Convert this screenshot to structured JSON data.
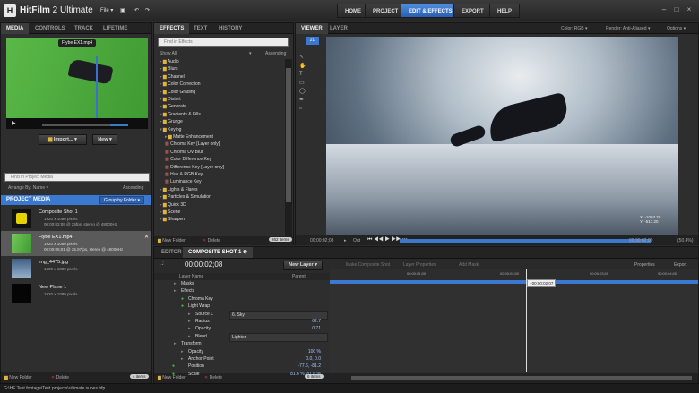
{
  "app": {
    "name": "HitFilm",
    "version": "2 Ultimate",
    "menu_file": "File",
    "undo": "↶",
    "redo": "↷"
  },
  "nav": [
    "HOME",
    "PROJECT",
    "EDIT & EFFECTS",
    "EXPORT",
    "HELP"
  ],
  "left_tabs": [
    "MEDIA",
    "CONTROLS",
    "TRACK",
    "LIFETIME"
  ],
  "preview": {
    "clip_label": "Flybe EX1.mp4"
  },
  "media_toolbar": {
    "import": "Import...",
    "new": "New"
  },
  "media_search_placeholder": "Find in Project Media",
  "arrange": {
    "label": "Arrange By: Name",
    "order": "Ascending"
  },
  "project_media": {
    "title": "PROJECT MEDIA",
    "group": "Group by Folder"
  },
  "media_items": [
    {
      "name": "Composite Shot 1",
      "meta1": "1920 x 1080 pixels",
      "meta2": "00:00:02;09 @ 25fps, stereo @ 48000Hz"
    },
    {
      "name": "Flybe EX1.mp4",
      "meta1": "1920 x 1080 pixels",
      "meta2": "00:00:05;01 @ 25.97fps, stereo @ 48000Hz"
    },
    {
      "name": "img_4475.jpg",
      "meta1": "1400 x 1300 pixels",
      "meta2": ""
    },
    {
      "name": "New Plane 1",
      "meta1": "1920 x 1080 pixels",
      "meta2": ""
    }
  ],
  "media_footer": {
    "new_folder": "New Folder",
    "delete": "Delete",
    "count": "4 items"
  },
  "effects_tabs": [
    "EFFECTS",
    "TEXT",
    "HISTORY"
  ],
  "effects_search_placeholder": "Find in Effects",
  "effects_show": {
    "label": "Show All",
    "order": "Ascending"
  },
  "effects": [
    {
      "label": "Audio",
      "type": "folder"
    },
    {
      "label": "Blurs",
      "type": "folder"
    },
    {
      "label": "Channel",
      "type": "folder"
    },
    {
      "label": "Color Correction",
      "type": "folder"
    },
    {
      "label": "Color Grading",
      "type": "folder"
    },
    {
      "label": "Distort",
      "type": "folder"
    },
    {
      "label": "Generate",
      "type": "folder"
    },
    {
      "label": "Gradients & Fills",
      "type": "folder"
    },
    {
      "label": "Grunge",
      "type": "folder"
    },
    {
      "label": "Keying",
      "type": "open"
    },
    {
      "label": "Matte Enhancement",
      "type": "sub-folder"
    },
    {
      "label": "Chroma Key [Layer only]",
      "type": "item"
    },
    {
      "label": "Chroma UV Blur",
      "type": "item"
    },
    {
      "label": "Color Difference Key",
      "type": "item"
    },
    {
      "label": "Difference Key [Layer only]",
      "type": "item"
    },
    {
      "label": "Hue & RGB Key",
      "type": "item"
    },
    {
      "label": "Luminance Key",
      "type": "item"
    },
    {
      "label": "Lights & Flares",
      "type": "folder"
    },
    {
      "label": "Particles & Simulation",
      "type": "folder"
    },
    {
      "label": "Quick 3D",
      "type": "folder"
    },
    {
      "label": "Scene",
      "type": "folder"
    },
    {
      "label": "Sharpen",
      "type": "folder"
    }
  ],
  "effects_footer": {
    "new_folder": "New Folder",
    "delete": "Delete",
    "count": "262 items"
  },
  "viewer": {
    "tabs": [
      "VIEWER",
      "LAYER"
    ],
    "badge": "2D",
    "color": "Color: RGB",
    "render": "Render: Anti-Aliased",
    "options": "Options",
    "coords": [
      "X: -1063.20",
      "Y: -517.20"
    ],
    "time_left": "00:00:02;08",
    "out": "Out",
    "time_right": "00:00:02;09",
    "zoom": "(50.4%)"
  },
  "editor_tabs": [
    "EDITOR",
    "COMPOSITE SHOT 1"
  ],
  "timeline": {
    "timecode": "00:00:02;08",
    "new_layer": "New Layer",
    "make_comp": "Make Composite Shot",
    "layer_props": "Layer Properties",
    "add_mask": "Add Mask",
    "properties": "Properties",
    "export": "Export",
    "col_layer": "Layer Name",
    "col_parent": "Parent",
    "marker": "+00:00:02;07",
    "ruler": [
      "00:00:00;00",
      "00:00:01;00",
      "00:00:02;00",
      "00:00:03;00",
      "00:00:04;00"
    ]
  },
  "layer_rows": [
    {
      "label": "Masks",
      "indent": 1,
      "value": ""
    },
    {
      "label": "Effects",
      "indent": 1,
      "value": ""
    },
    {
      "label": "Chroma Key",
      "indent": 2,
      "value": ""
    },
    {
      "label": "Light Wrap",
      "indent": 2,
      "value": ""
    },
    {
      "label": "Source L",
      "indent": 3,
      "value": "6. Sky"
    },
    {
      "label": "Radius",
      "indent": 3,
      "value": "62.7"
    },
    {
      "label": "Opacity",
      "indent": 3,
      "value": "0.71"
    },
    {
      "label": "Blend",
      "indent": 3,
      "value": "Lighten"
    },
    {
      "label": "Transform",
      "indent": 1,
      "value": ""
    },
    {
      "label": "Opacity",
      "indent": 2,
      "value": "100 %"
    },
    {
      "label": "Anchor Point",
      "indent": 2,
      "value": "0.0, 0.0"
    },
    {
      "label": "Position",
      "indent": 2,
      "value": "-77.6, -81.2"
    },
    {
      "label": "Scale",
      "indent": 2,
      "value": "81.6 %, 81.6 %"
    }
  ],
  "tl_footer": {
    "new_folder": "New Folder",
    "delete": "Delete",
    "count": "6 items"
  },
  "status": "G:\\HF Test footage\\Test projects\\ultimate supes.hfp"
}
